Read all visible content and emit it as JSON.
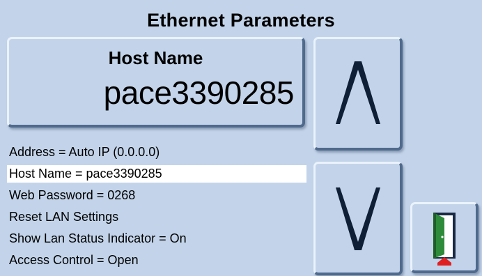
{
  "title": "Ethernet Parameters",
  "host_box": {
    "label": "Host Name",
    "value": "pace3390285"
  },
  "list": [
    {
      "text": "Address = Auto IP (0.0.0.0)",
      "selected": false
    },
    {
      "text": "Host Name = pace3390285",
      "selected": true
    },
    {
      "text": "Web Password = 0268",
      "selected": false
    },
    {
      "text": "Reset LAN Settings",
      "selected": false
    },
    {
      "text": "Show Lan Status Indicator = On",
      "selected": false
    },
    {
      "text": "Access Control = Open",
      "selected": false
    }
  ],
  "buttons": {
    "up_icon": "chevron-up-icon",
    "down_icon": "chevron-down-icon",
    "exit_icon": "exit-door-icon"
  },
  "colors": {
    "background": "#c3d4ea",
    "selected_row": "#ffffff",
    "arrow": "#0f2036",
    "door_green": "#2e8b3a",
    "door_red": "#e02020"
  }
}
